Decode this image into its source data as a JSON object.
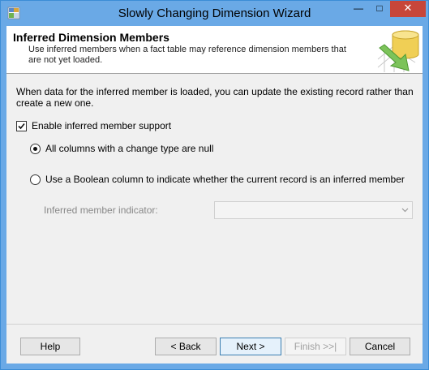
{
  "window": {
    "title": "Slowly Changing Dimension Wizard",
    "controls": {
      "minimize": "—",
      "maximize": "□",
      "close": "✕"
    },
    "accent_color": "#6aa9e6",
    "close_color": "#c7463a"
  },
  "header": {
    "title": "Inferred Dimension Members",
    "description": "Use inferred members when a fact table may reference dimension members that are not yet loaded."
  },
  "body": {
    "intro": "When data for the inferred member is loaded, you can update the existing record rather than create a new one.",
    "enable_checkbox": {
      "label": "Enable inferred member support",
      "checked": true
    },
    "radio_options": [
      {
        "label": "All columns with a change type are null",
        "selected": true
      },
      {
        "label": "Use a Boolean column to indicate whether the current record is an inferred member",
        "selected": false
      }
    ],
    "indicator": {
      "label": "Inferred member indicator:",
      "value": ""
    }
  },
  "footer": {
    "help_label": "Help",
    "back_label": "< Back",
    "next_label": "Next >",
    "finish_label": "Finish >>|",
    "cancel_label": "Cancel"
  }
}
